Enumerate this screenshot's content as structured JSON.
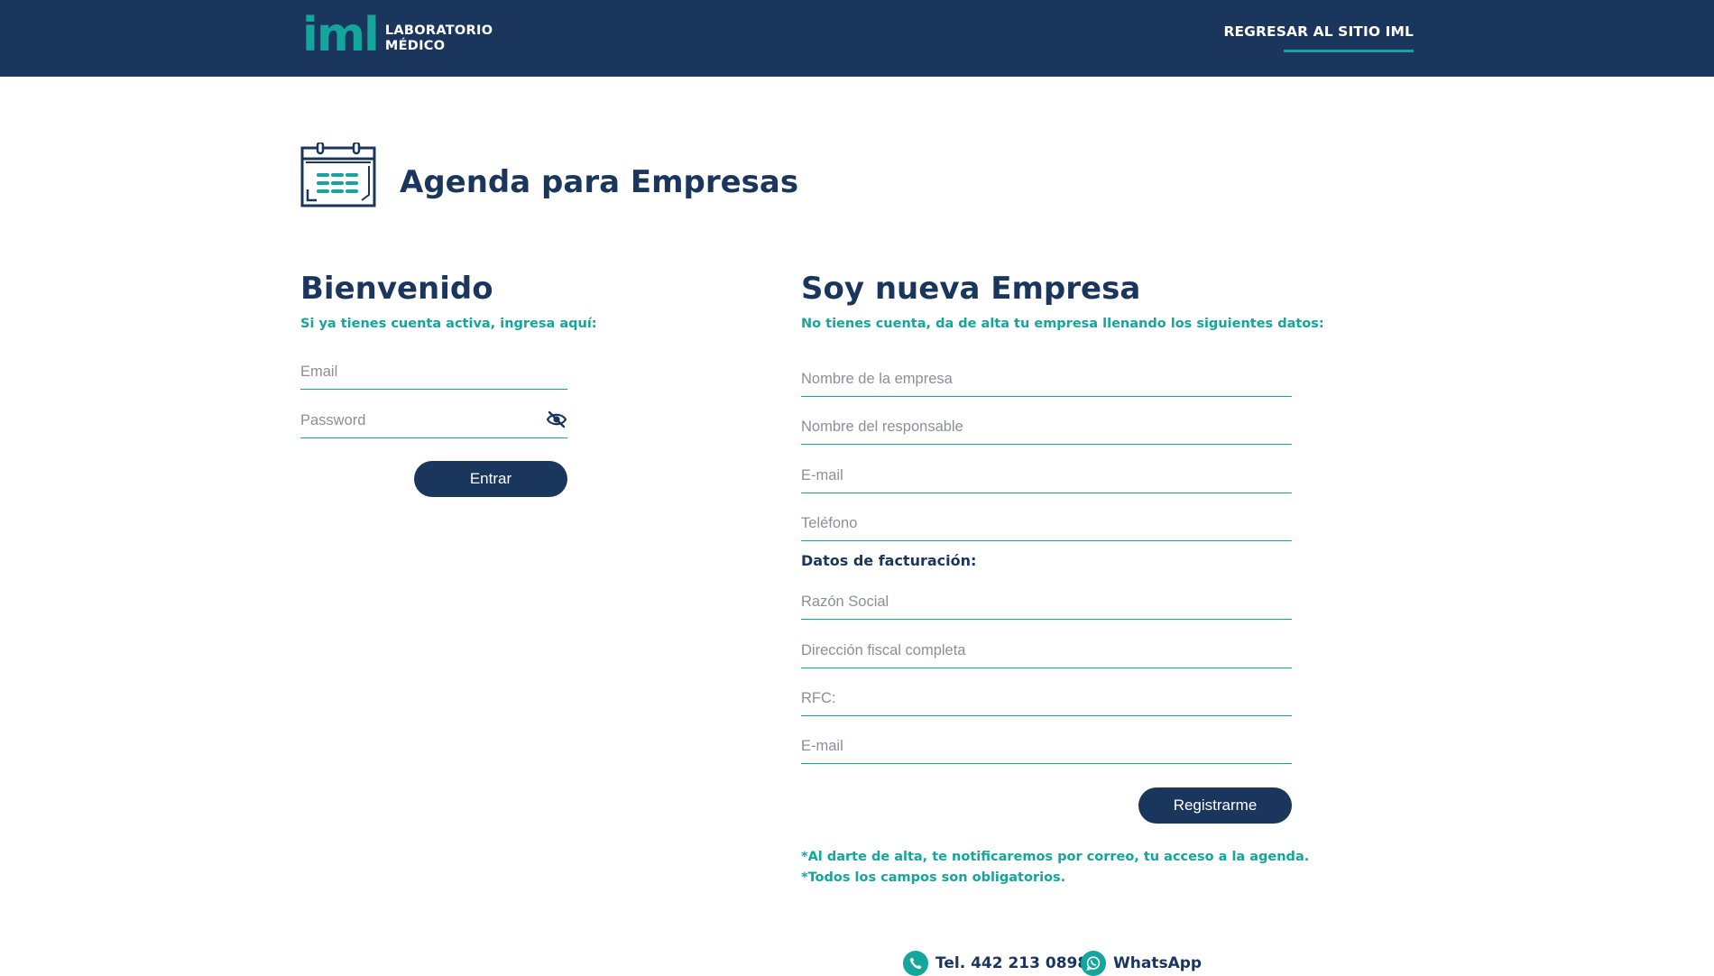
{
  "header": {
    "logo_mark": "iml",
    "logo_line1": "LABORATORIO",
    "logo_line2": "MÉDICO",
    "back_link": "REGRESAR AL SITIO IML"
  },
  "title": {
    "icon": "calendar-icon",
    "text": "Agenda para Empresas"
  },
  "login": {
    "heading": "Bienvenido",
    "subheading": "Si ya tienes cuenta activa, ingresa aquí:",
    "email_placeholder": "Email",
    "password_placeholder": "Password",
    "toggle_icon": "eye-slash-icon",
    "submit_label": "Entrar"
  },
  "register": {
    "heading": "Soy nueva Empresa",
    "subheading": "No tienes cuenta, da de alta tu empresa llenando los siguientes datos:",
    "company_placeholder": "Nombre de la empresa",
    "responsible_placeholder": "Nombre del responsable",
    "email_placeholder": "E-mail",
    "phone_placeholder": "Teléfono",
    "billing_label": "Datos de facturación:",
    "business_name_placeholder": "Razón Social",
    "address_placeholder": "Dirección fiscal completa",
    "rfc_placeholder": "RFC:",
    "billing_email_placeholder": "E-mail",
    "submit_label": "Registrarme",
    "note_1": "*Al darte de alta, te notificaremos por correo, tu acceso a la agenda.",
    "note_2": "*Todos los campos son obligatorios."
  },
  "footer": {
    "phone_icon": "phone-icon",
    "phone_text": "Tel. 442 213 0898",
    "whatsapp_icon": "whatsapp-icon",
    "whatsapp_text": "WhatsApp"
  },
  "colors": {
    "navy": "#1b365d",
    "teal": "#14a59c",
    "placeholder": "#8a8f99",
    "background": "#ffffff"
  }
}
